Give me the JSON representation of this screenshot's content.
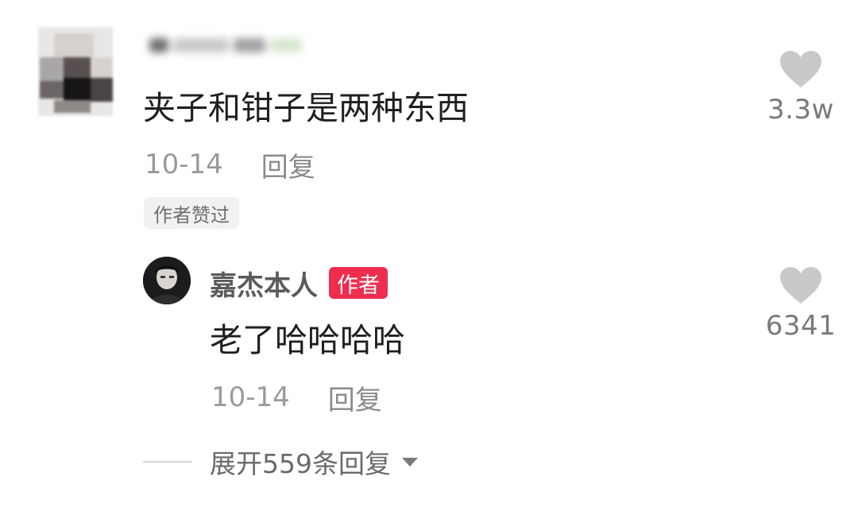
{
  "comment": {
    "text": "夹子和钳子是两种东西",
    "date": "10-14",
    "reply_label": "回复",
    "badge": "作者赞过",
    "likes": "3.3w"
  },
  "reply": {
    "username": "嘉杰本人",
    "author_tag": "作者",
    "text": "老了哈哈哈哈",
    "date": "10-14",
    "reply_label": "回复",
    "likes": "6341"
  },
  "expand": {
    "label": "展开559条回复"
  },
  "colors": {
    "author_tag": "#ee2d4f",
    "heart": "#c9c9c9"
  },
  "icons": {
    "like": "heart-icon",
    "expand": "caret-down-icon"
  }
}
